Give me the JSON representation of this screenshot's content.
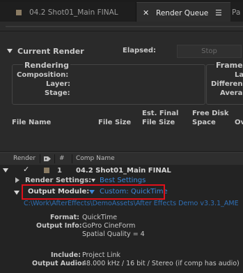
{
  "tabs": [
    {
      "label": "04.2 Shot01_Main FINAL",
      "active": false
    },
    {
      "label": "Render Queue",
      "active": true
    },
    {
      "label": "Pa",
      "active": false
    }
  ],
  "current_render": {
    "title": "Current Render",
    "elapsed_label": "Elapsed:",
    "stop_label": "Stop",
    "rendering": {
      "title": "Rendering",
      "composition_label": "Composition:",
      "layer_label": "Layer:",
      "stage_label": "Stage:"
    },
    "frame": {
      "title": "Frame",
      "last_label": "La",
      "difference_label": "Differen",
      "average_label": "Avera"
    },
    "file_name_label": "File Name",
    "file_size_label": "File Size",
    "est_final_label_1": "Est. Final",
    "est_final_label_2": "File Size",
    "free_disk_label_1": "Free Disk",
    "free_disk_label_2": "Space",
    "overflow_label": "Ov"
  },
  "columns": {
    "render": "Render",
    "number": "#",
    "comp_name": "Comp Name"
  },
  "queue_item": {
    "number": "1",
    "comp_name": "04.2 Shot01_Main FINAL",
    "render_settings_label": "Render Settings:",
    "render_settings_value": "Best Settings",
    "output_module_label": "Output Module:",
    "output_module_value": "Custom: QuickTime",
    "output_path": "C:\\Work\\AfterEffects\\DemoAssets\\After Effects Demo v3.3.1_AME",
    "format_label": "Format:",
    "format_value": "QuickTime",
    "output_info_label": "Output Info:",
    "output_info_value_1": "GoPro CineForm",
    "output_info_value_2": "Spatial Quality = 4",
    "include_label": "Include:",
    "include_value": "Project Link",
    "output_audio_label": "Output Audio:",
    "output_audio_value": "48.000 kHz / 16 bit / Stereo (if comp has audio)"
  },
  "colors": {
    "link": "#3d88d8",
    "highlight_box": "#e0101a",
    "label_swatch": "#8a7b63"
  }
}
